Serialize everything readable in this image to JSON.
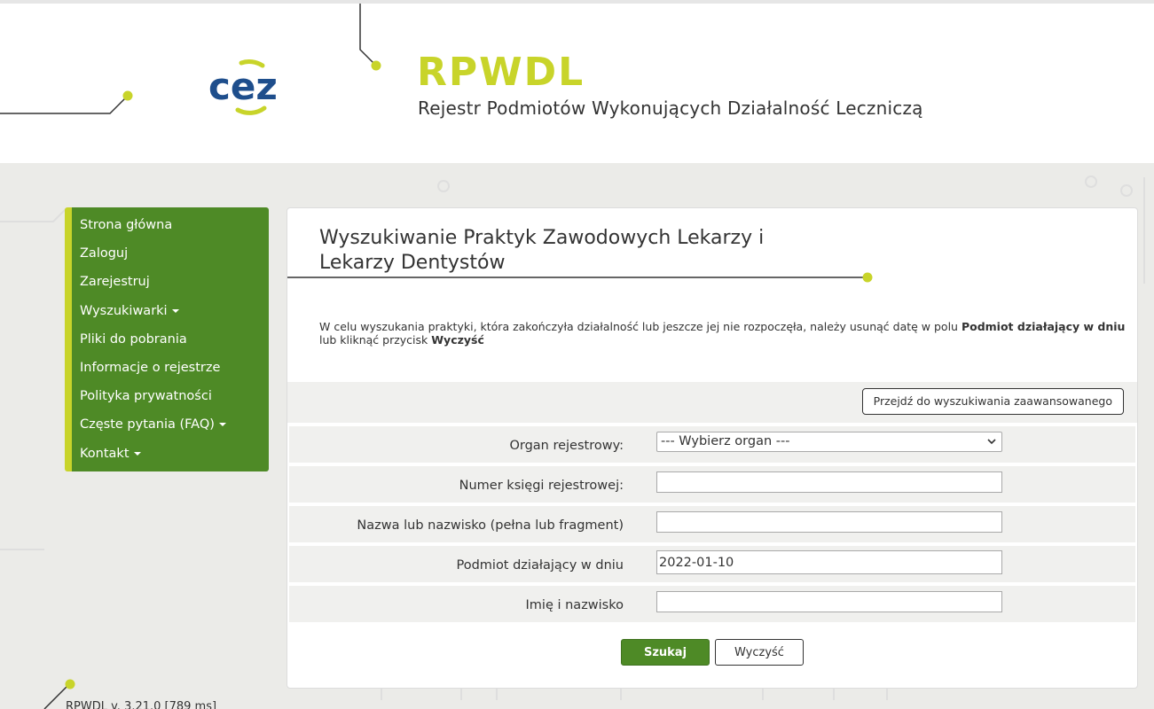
{
  "brand": {
    "logo_text": "cez",
    "title": "RPWDL",
    "subtitle": "Rejestr Podmiotów Wykonujących Działalność Leczniczą",
    "accent_color": "#c8d42a",
    "logo_color": "#1e4e8c"
  },
  "sidebar": {
    "items": [
      {
        "label": "Strona główna",
        "has_dropdown": false
      },
      {
        "label": "Zaloguj",
        "has_dropdown": false
      },
      {
        "label": "Zarejestruj",
        "has_dropdown": false
      },
      {
        "label": "Wyszukiwarki",
        "has_dropdown": true
      },
      {
        "label": "Pliki do pobrania",
        "has_dropdown": false
      },
      {
        "label": "Informacje o rejestrze",
        "has_dropdown": false
      },
      {
        "label": "Polityka prywatności",
        "has_dropdown": false
      },
      {
        "label": "Częste pytania (FAQ)",
        "has_dropdown": true
      },
      {
        "label": "Kontakt",
        "has_dropdown": true
      }
    ],
    "background_color": "#4e8a26"
  },
  "main": {
    "title": "Wyszukiwanie Praktyk Zawodowych Lekarzy i Lekarzy Dentystów",
    "notice": {
      "text_before": "W celu wyszukania praktyki, która zakończyła działalność lub jeszcze jej nie rozpoczęła, należy usunąć datę w polu ",
      "field_name": "Podmiot działający w dniu",
      "text_middle": " lub kliknąć przycisk ",
      "button_name": "Wyczyść"
    },
    "advanced_search_label": "Przejdź do wyszukiwania zaawansowanego",
    "form": {
      "organ": {
        "label": "Organ rejestrowy:",
        "selected": "--- Wybierz organ ---"
      },
      "book_number": {
        "label": "Numer księgi rejestrowej:",
        "value": ""
      },
      "name": {
        "label": "Nazwa lub nazwisko (pełna lub fragment)",
        "value": ""
      },
      "active_date": {
        "label": "Podmiot działający w dniu",
        "value": "2022-01-10"
      },
      "person_name": {
        "label": "Imię i nazwisko",
        "value": ""
      }
    },
    "search_button": "Szukaj",
    "clear_button": "Wyczyść"
  },
  "footer": {
    "version_text": "RPWDL v. 3.21.0 [789 ms]"
  }
}
